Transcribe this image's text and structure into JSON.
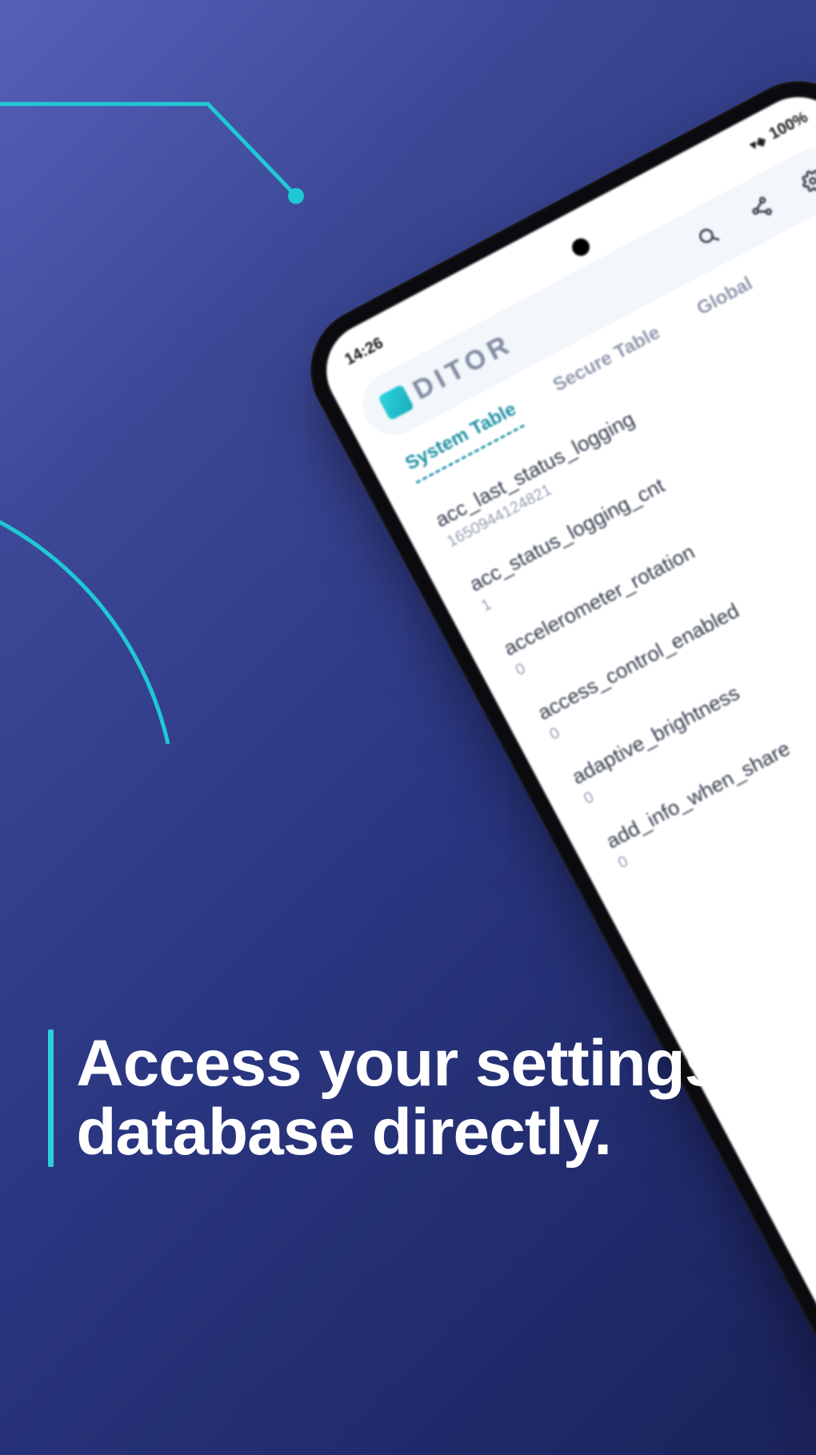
{
  "caption": {
    "text": "Access your settings database directly."
  },
  "phone": {
    "status_bar": {
      "time": "14:26",
      "battery": "100%"
    },
    "app_bar": {
      "title": "DITOR",
      "icons": {
        "search": "search-icon",
        "share": "share-icon",
        "settings": "gear-icon"
      }
    },
    "tabs": [
      {
        "label": "System Table",
        "active": true
      },
      {
        "label": "Secure Table",
        "active": false
      },
      {
        "label": "Global",
        "active": false
      }
    ],
    "items": [
      {
        "key": "acc_last_status_logging",
        "val": "1650944124821"
      },
      {
        "key": "acc_status_logging_cnt",
        "val": "1"
      },
      {
        "key": "accelerometer_rotation",
        "val": "0"
      },
      {
        "key": "access_control_enabled",
        "val": "0"
      },
      {
        "key": "adaptive_brightness",
        "val": "0"
      },
      {
        "key": "add_info_when_share",
        "val": "0"
      }
    ]
  }
}
